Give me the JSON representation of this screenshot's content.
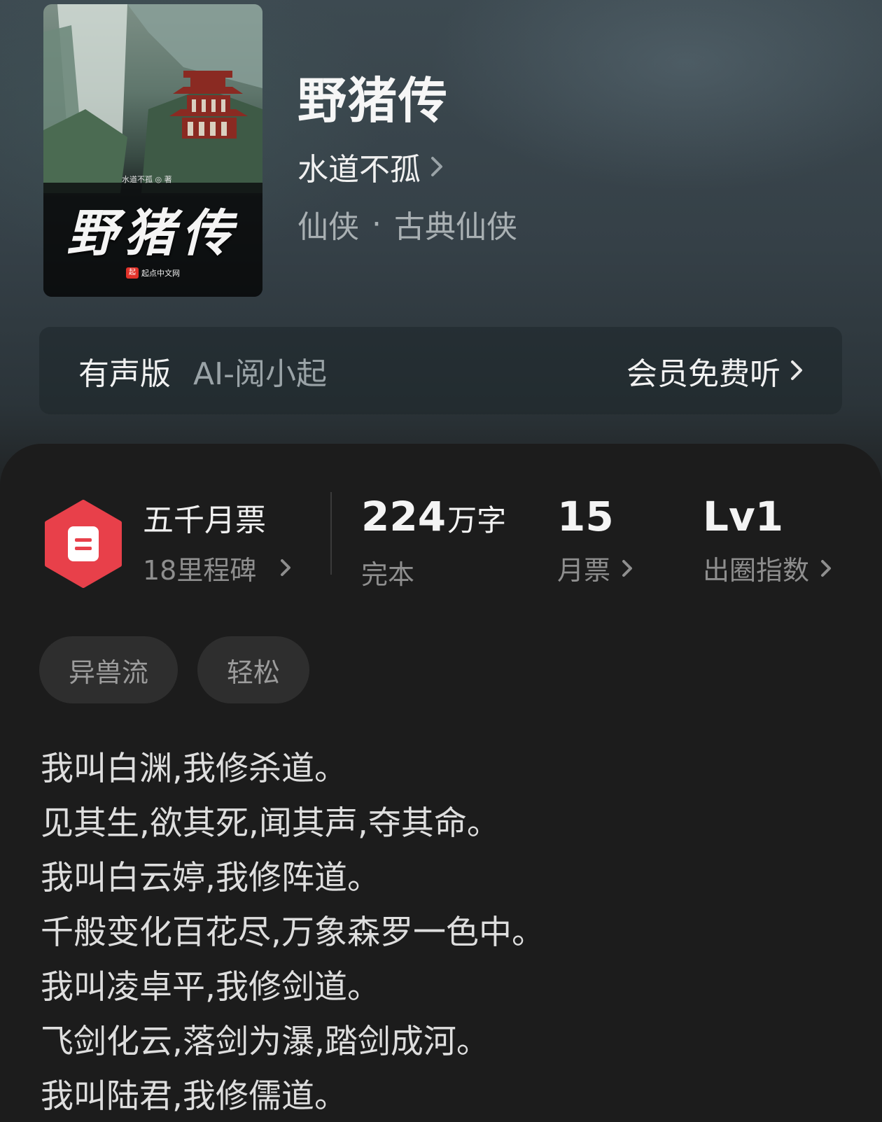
{
  "book": {
    "title": "野猪传",
    "author": "水道不孤",
    "genre": "仙侠",
    "subgenre": "古典仙侠",
    "genre_separator": "·"
  },
  "cover": {
    "title_text": "野猪传",
    "author_text": "水道不孤 ◎ 著",
    "publisher_text": "起点中文网",
    "publisher_logo": "起"
  },
  "audio": {
    "label": "有声版",
    "voice": "AI-阅小起",
    "action": "会员免费听"
  },
  "milestone": {
    "title": "五千月票",
    "subtitle": "18里程碑",
    "badge_color": "#e8404a"
  },
  "stats": {
    "words": {
      "value": "224",
      "unit": "万字",
      "label": "完本"
    },
    "tickets": {
      "value": "15",
      "label": "月票"
    },
    "level": {
      "value": "Lv1",
      "label": "出圈指数"
    }
  },
  "tags": [
    "异兽流",
    "轻松"
  ],
  "synopsis": [
    "我叫白渊,我修杀道。",
    "见其生,欲其死,闻其声,夺其命。",
    "我叫白云婷,我修阵道。",
    "千般变化百花尽,万象森罗一色中。",
    "我叫凌卓平,我修剑道。",
    "飞剑化云,落剑为瀑,踏剑成河。",
    "我叫陆君,我修儒道。"
  ]
}
